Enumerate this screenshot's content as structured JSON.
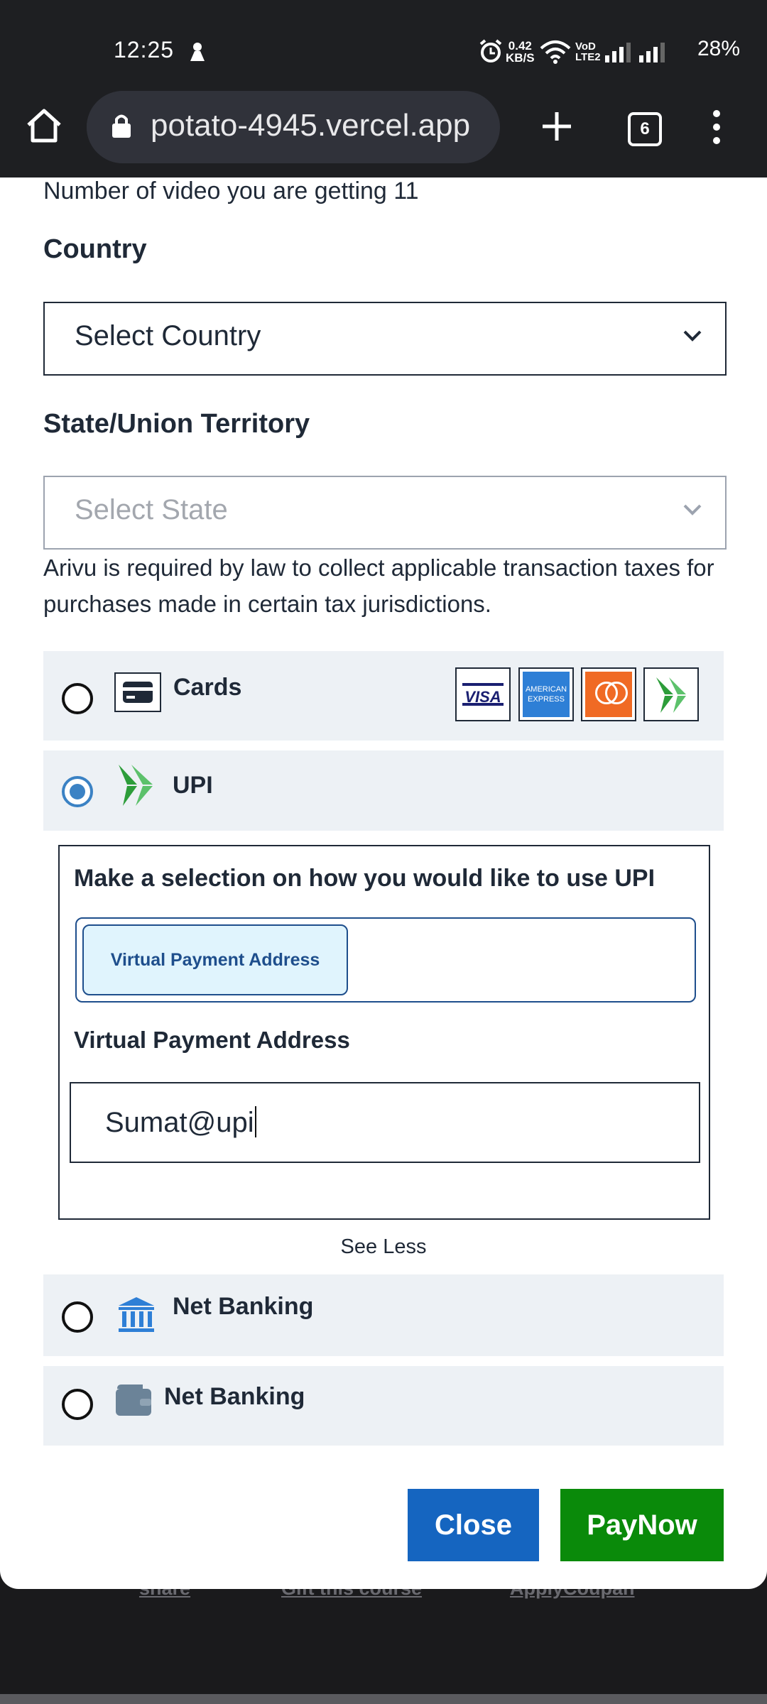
{
  "status_bar": {
    "time": "12:25",
    "net_speed_value": "0.42",
    "net_speed_unit": "KB/S",
    "vo_line1": "VoD",
    "vo_line2": "LTE2",
    "battery": "28%"
  },
  "browser": {
    "url": "potato-4945.vercel.app",
    "tab_count": "6"
  },
  "modal": {
    "video_count_text": "Number of video you are getting 11",
    "country_label": "Country",
    "country_select_value": "Select Country",
    "state_label": "State/Union Territory",
    "state_select_value": "Select State",
    "tax_notice": "Arivu is required by law to collect applicable transaction taxes for purchases made in certain tax jurisdictions.",
    "payment_options": {
      "cards_label": "Cards",
      "card_brands": [
        "visa-icon",
        "amex-icon",
        "mastercard-icon",
        "upi-brand-icon"
      ],
      "upi_label": "UPI",
      "netbanking_label": "Net Banking",
      "wallet_label": "Net Banking",
      "selected": "UPI"
    },
    "upi_panel": {
      "prompt": "Make a selection on how you would like to use UPI",
      "option_button": "Virtual Payment Address",
      "field_label": "Virtual Payment Address",
      "field_value": "Sumat@upi"
    },
    "see_less": "See Less",
    "close_button": "Close",
    "pay_button": "PayNow"
  },
  "background_page": {
    "share_link": "share",
    "gift_link": "Gift this course",
    "coupon_link": "ApplyCoupan"
  },
  "colors": {
    "accent_blue": "#1565c0",
    "pay_green": "#0a8a0a",
    "radio_selected": "#3b82c4",
    "option_bg": "#edf1f5"
  }
}
